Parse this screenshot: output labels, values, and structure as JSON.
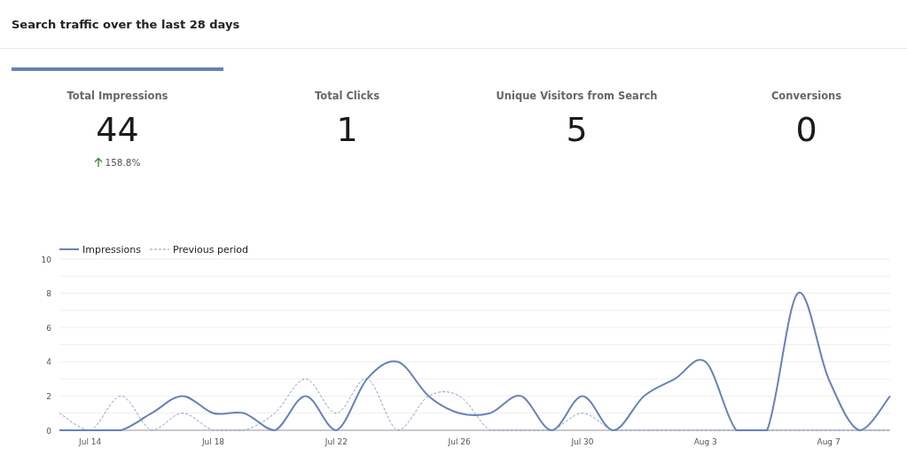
{
  "title": "Search traffic over the last 28 days",
  "metrics": [
    {
      "label": "Total Impressions",
      "value": "44",
      "selected": true,
      "change": {
        "text": "158.8%"
      }
    },
    {
      "label": "Total Clicks",
      "value": "1",
      "selected": false
    },
    {
      "label": "Unique Visitors from Search",
      "value": "5",
      "selected": false
    },
    {
      "label": "Conversions",
      "value": "0",
      "selected": false
    }
  ],
  "chart": {
    "chart_data": {
      "type": "line",
      "categories": [
        null,
        "Jul 14",
        null,
        null,
        null,
        "Jul 18",
        null,
        null,
        null,
        "Jul 22",
        null,
        null,
        null,
        "Jul 26",
        null,
        null,
        null,
        "Jul 30",
        null,
        null,
        null,
        "Aug 3",
        null,
        null,
        null,
        "Aug 7",
        null,
        null
      ],
      "series": [
        {
          "name": "Impressions",
          "color": "#6781b9",
          "line_style": "solid",
          "values": [
            0,
            0,
            0,
            1,
            2,
            1,
            1,
            0,
            2,
            0,
            3,
            4,
            2,
            1,
            1,
            2,
            0,
            2,
            0,
            2,
            3,
            4,
            0,
            0,
            8,
            3,
            0,
            2
          ]
        },
        {
          "name": "Previous period",
          "color": "#8a9dc8",
          "line_style": "dashed",
          "values": [
            1,
            0,
            2,
            0,
            1,
            0,
            0,
            1,
            3,
            1,
            3,
            0,
            2,
            2,
            0,
            0,
            0,
            1,
            0,
            0,
            0,
            0,
            0,
            0,
            0,
            0,
            0,
            0
          ]
        }
      ],
      "ylim": [
        0,
        10
      ],
      "yticks": [
        0,
        2,
        4,
        6,
        8,
        10
      ],
      "grid": true,
      "legend": "top"
    }
  }
}
